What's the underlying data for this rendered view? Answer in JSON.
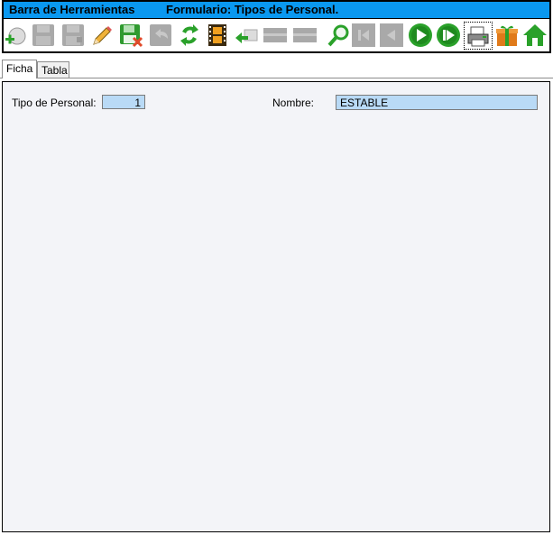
{
  "toolbar": {
    "title_left": "Barra de Herramientas",
    "title_right": "Formulario: Tipos de Personal.",
    "title_bg": "#0a98f0",
    "buttons": [
      {
        "icon": "add-icon",
        "enabled": true
      },
      {
        "icon": "save-icon",
        "enabled": false
      },
      {
        "icon": "save-as-icon",
        "enabled": false
      },
      {
        "icon": "edit-pencil-icon",
        "enabled": true
      },
      {
        "icon": "save-delete-icon",
        "enabled": true
      },
      {
        "icon": "undo-icon",
        "enabled": false
      },
      {
        "icon": "refresh-icon",
        "enabled": true
      },
      {
        "icon": "film-icon",
        "enabled": true
      },
      {
        "icon": "back-arrow-icon",
        "enabled": true
      },
      {
        "icon": "bar-icon",
        "enabled": false
      },
      {
        "icon": "bar-icon",
        "enabled": false
      },
      {
        "icon": "search-icon",
        "enabled": true
      },
      {
        "icon": "first-record-icon",
        "enabled": false
      },
      {
        "icon": "previous-record-icon",
        "enabled": false
      },
      {
        "icon": "next-record-icon",
        "enabled": true
      },
      {
        "icon": "last-record-icon",
        "enabled": true
      },
      {
        "icon": "printer-icon",
        "enabled": true
      },
      {
        "icon": "gift-icon",
        "enabled": true
      },
      {
        "icon": "home-icon",
        "enabled": true
      }
    ]
  },
  "tabs": [
    {
      "label": "Ficha",
      "active": true
    },
    {
      "label": "Tabla",
      "active": false
    }
  ],
  "form": {
    "tipo_label": "Tipo de Personal:",
    "tipo_value": "1",
    "nombre_label": "Nombre:",
    "nombre_value": "ESTABLE",
    "field_bg": "#b9daf6",
    "panel_bg": "#f3f4f8"
  }
}
